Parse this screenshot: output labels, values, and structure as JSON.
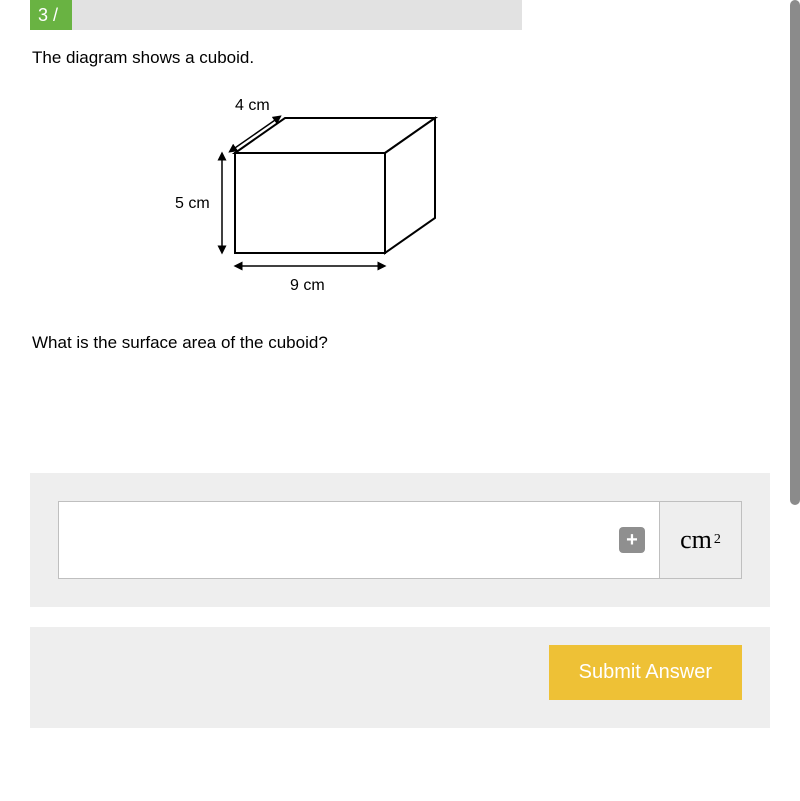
{
  "question": {
    "number": "3 /",
    "intro": "The diagram shows a cuboid.",
    "prompt": "What is the surface area of the cuboid?"
  },
  "diagram": {
    "top_label": "4 cm",
    "left_label": "5 cm",
    "bottom_label": "9 cm"
  },
  "answer": {
    "value": "",
    "unit": "cm",
    "unit_exp": "2",
    "plus_glyph": "+"
  },
  "buttons": {
    "submit": "Submit Answer"
  }
}
